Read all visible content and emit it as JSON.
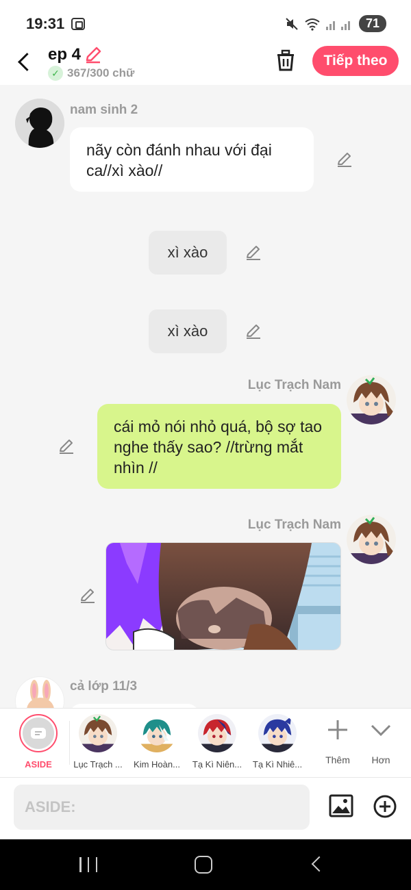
{
  "status_bar": {
    "time": "19:31",
    "mute_icon": "mute-icon",
    "wifi_icon": "wifi-icon",
    "signal_icon": "signal-icon",
    "battery": "71"
  },
  "header": {
    "title": "ep 4",
    "word_count": "367/300 chữ",
    "next_label": "Tiếp theo",
    "accent_color": "#ff4d6d"
  },
  "messages": [
    {
      "type": "left",
      "speaker": "nam sinh 2",
      "text": "nãy còn đánh nhau với đại ca//xì xào//"
    },
    {
      "type": "sound",
      "text": "xì xào"
    },
    {
      "type": "sound",
      "text": "xì xào"
    },
    {
      "type": "right",
      "speaker": "Lục Trạch Nam",
      "text": "cái mỏ nói nhỏ quá, bộ sợ tao nghe thấy sao? //trừng mắt nhìn //"
    },
    {
      "type": "right-image",
      "speaker": "Lục Trạch Nam"
    },
    {
      "type": "left-partial",
      "speaker": "cả lớp 11/3"
    }
  ],
  "characters": {
    "aside_label": "ASIDE",
    "items": [
      {
        "name": "Lục Trạch ..."
      },
      {
        "name": "Kim Hoàn..."
      },
      {
        "name": "Tạ Kì Niên..."
      },
      {
        "name": "Tạ Kì Nhiê..."
      }
    ],
    "add_label": "Thêm",
    "more_label": "Hơn"
  },
  "input": {
    "placeholder": "ASIDE:"
  }
}
